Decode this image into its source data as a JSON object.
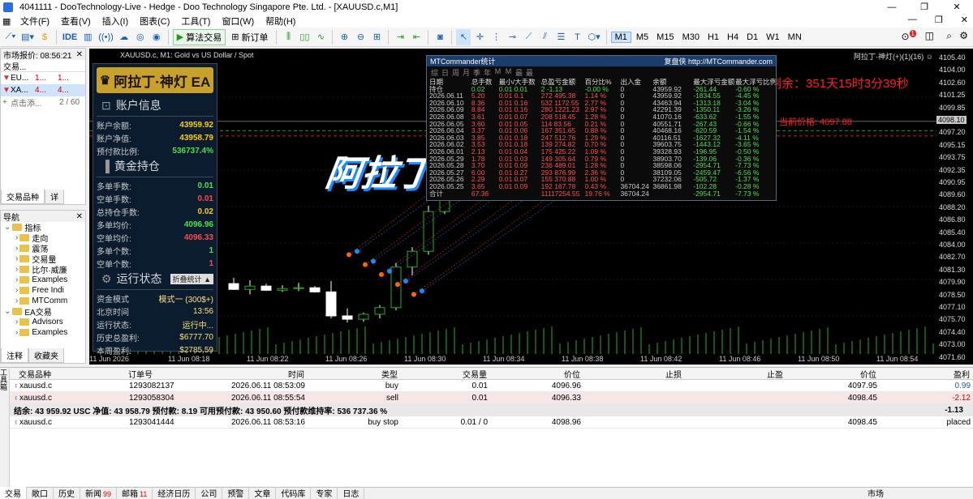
{
  "window": {
    "title": "4041111 - DooTechnology-Live - Hedge - Doo Technology Singapore Pte. Ltd. - [XAUUSD.c,M1]"
  },
  "menu": [
    "文件(F)",
    "查看(V)",
    "插入(I)",
    "图表(C)",
    "工具(T)",
    "窗口(W)",
    "帮助(H)"
  ],
  "toolbar": {
    "ide": "IDE",
    "algo_label": "算法交易",
    "new_order_label": "新订单",
    "timeframes": [
      "M1",
      "M5",
      "M15",
      "M30",
      "H1",
      "H4",
      "D1",
      "W1",
      "MN"
    ],
    "selected_tf": "M1",
    "alerts_badge": "1"
  },
  "market_watch": {
    "header": "市场报价: 08:56:21",
    "col_symbol": "交易...",
    "rows": [
      {
        "symbol": "EU...",
        "bid": "1...",
        "ask": "1..."
      },
      {
        "symbol": "XA...",
        "bid": "4...",
        "ask": "4..."
      }
    ],
    "add_label": "点击添...",
    "count": "2 / 60",
    "tabs": [
      "交易品种",
      "详"
    ]
  },
  "navigator": {
    "header": "导航",
    "items": [
      {
        "label": "指标",
        "level": 1
      },
      {
        "label": "走向",
        "level": 2
      },
      {
        "label": "震荡",
        "level": 2
      },
      {
        "label": "交易量",
        "level": 2
      },
      {
        "label": "比尔·威廉",
        "level": 2
      },
      {
        "label": "Examples",
        "level": 2
      },
      {
        "label": "Free Indi",
        "level": 2
      },
      {
        "label": "MTComm",
        "level": 2
      },
      {
        "label": "EA交易",
        "level": 1
      },
      {
        "label": "Advisors",
        "level": 2
      },
      {
        "label": "Examples",
        "level": 2
      }
    ],
    "tabs": [
      "注释",
      "收藏夹"
    ]
  },
  "chart": {
    "symbol_title": "XAUUSD.c, M1: Gold vs US Dollar / Spot",
    "ea_name_top": "阿拉丁·神灯(+)(1)(16) ☺",
    "countdown": "剩余：351天15时3分39秒",
    "price_tag": "当前价格: 4097.88",
    "big_text": "阿拉丁",
    "price_labels": [
      "4105.40",
      "4104.00",
      "4102.60",
      "4101.25",
      "4099.85",
      "4098.10",
      "4097.20",
      "4095.15",
      "4093.75",
      "4092.35",
      "4090.95",
      "4089.60",
      "4088.20",
      "4086.80",
      "4085.40",
      "4084.00",
      "4082.70",
      "4081.30",
      "4079.90",
      "4078.50",
      "4077.10",
      "4075.70",
      "4074.40",
      "4073.00",
      "4071.60"
    ],
    "current_price_label": "4098.10",
    "time_labels": [
      "11 Jun 2026",
      "11 Jun 08:18",
      "11 Jun 08:22",
      "11 Jun 08:26",
      "11 Jun 08:30",
      "11 Jun 08:34",
      "11 Jun 08:38",
      "11 Jun 08:42",
      "11 Jun 08:46",
      "11 Jun 08:50",
      "11 Jun 08:54"
    ],
    "candles": [
      {
        "o": 4078.5,
        "h": 4079.2,
        "l": 4077.9,
        "c": 4077.8
      },
      {
        "o": 4077.8,
        "h": 4078.9,
        "l": 4077.2,
        "c": 4078.2
      },
      {
        "o": 4078.2,
        "h": 4078.5,
        "l": 4077.6,
        "c": 4077.7
      },
      {
        "o": 4077.7,
        "h": 4078.3,
        "l": 4077.5,
        "c": 4077.9
      },
      {
        "o": 4077.9,
        "h": 4078.6,
        "l": 4077.6,
        "c": 4078.0
      },
      {
        "o": 4078.0,
        "h": 4078.2,
        "l": 4077.4,
        "c": 4077.5
      },
      {
        "o": 4077.5,
        "h": 4078.8,
        "l": 4074.3,
        "c": 4074.6
      },
      {
        "o": 4074.6,
        "h": 4075.5,
        "l": 4073.8,
        "c": 4074.2
      },
      {
        "o": 4074.2,
        "h": 4075.0,
        "l": 4073.9,
        "c": 4074.8
      },
      {
        "o": 4074.8,
        "h": 4075.9,
        "l": 4074.3,
        "c": 4075.6
      },
      {
        "o": 4075.6,
        "h": 4081.0,
        "l": 4075.3,
        "c": 4080.5
      },
      {
        "o": 4080.5,
        "h": 4082.9,
        "l": 4079.5,
        "c": 4082.4
      },
      {
        "o": 4082.4,
        "h": 4087.9,
        "l": 4082.0,
        "c": 4087.2
      },
      {
        "o": 4087.2,
        "h": 4093.5,
        "l": 4086.9,
        "c": 4092.8
      }
    ]
  },
  "ea_panel": {
    "title": "阿拉丁·神灯 EA",
    "account_header": "账户信息",
    "account": [
      {
        "label": "账户余额:",
        "value": "43959.92",
        "cls": "y"
      },
      {
        "label": "账户净值:",
        "value": "43958.79",
        "cls": "y"
      },
      {
        "label": "预付款比例:",
        "value": "536737.4%",
        "cls": "g"
      }
    ],
    "gold_header": "黄金持仓",
    "gold": [
      {
        "label": "多单手数:",
        "value": "0.01",
        "cls": "g"
      },
      {
        "label": "空单手数:",
        "value": "0.01",
        "cls": "r"
      },
      {
        "label": "总持仓手数:",
        "value": "0.02",
        "cls": "y"
      },
      {
        "label": "多单均价:",
        "value": "4096.96",
        "cls": "g"
      },
      {
        "label": "空单均价:",
        "value": "4096.33",
        "cls": "r"
      },
      {
        "label": "多单个数:",
        "value": "1",
        "cls": "g"
      },
      {
        "label": "空单个数:",
        "value": "1",
        "cls": "r"
      }
    ],
    "run_header": "运行状态",
    "run_toggle": "折叠统计 ▲",
    "run": [
      {
        "label": "资金模式",
        "value": "模式一 (300$+)"
      },
      {
        "label": "北京时间",
        "value": "13:56"
      },
      {
        "label": "运行状态:",
        "value": "运行中..."
      },
      {
        "label": "历史总盈利:",
        "value": "$6777.70"
      },
      {
        "label": "本周盈利:",
        "value": "$2785.59"
      }
    ]
  },
  "mtc": {
    "title": "MTCommander统计",
    "brand": "复盘侠 http://MTCommander.com",
    "tabs": [
      "综",
      "日",
      "周",
      "月",
      "季",
      "年",
      "M",
      "M",
      "最",
      "最"
    ],
    "headers": [
      "日期",
      "总手数",
      "最小/大手数",
      "总盈亏金额",
      "百分比%",
      "出入金",
      "余额",
      "最大浮亏金额",
      "最大浮亏比例"
    ],
    "rows": [
      [
        "持仓",
        "0.02",
        "0.01 0.01",
        "2 -1.13",
        "-0.00 %",
        "0",
        "43959.92",
        "-261.44",
        "-0.60 %"
      ],
      [
        "2026.06.11",
        "5.20",
        "0.01 0.1",
        "272 495.38",
        "1.14 %",
        "0",
        "43959.92",
        "-1834.55",
        "-4.45 %"
      ],
      [
        "2026.06.10",
        "8.36",
        "0.01 0.16",
        "532 1172.55",
        "2.77 %",
        "0",
        "43463.94",
        "-1313.18",
        "-3.04 %"
      ],
      [
        "2026.06.09",
        "8.84",
        "0.01 0.16",
        "280 1221.23",
        "2.97 %",
        "0",
        "42291.39",
        "-1350.11",
        "-3.26 %"
      ],
      [
        "2026.06.08",
        "3.61",
        "0.01 0.07",
        "208 518.45",
        "1.28 %",
        "0",
        "41070.16",
        "-633.62",
        "-1.55 %"
      ],
      [
        "2026.06.05",
        "3.60",
        "0.01 0.05",
        "114 83.56",
        "0.21 %",
        "0",
        "40551.71",
        "-267.43",
        "-0.66 %"
      ],
      [
        "2026.06.04",
        "3.37",
        "0.01 0.06",
        "167 351.65",
        "0.88 %",
        "0",
        "40468.16",
        "-620.59",
        "-1.54 %"
      ],
      [
        "2026.06.03",
        "3.85",
        "0.01 0.18",
        "247 512.76",
        "1.29 %",
        "0",
        "40116.51",
        "-1627.32",
        "-4.11 %"
      ],
      [
        "2026.06.02",
        "3.53",
        "0.01 0.18",
        "139 274.82",
        "0.70 %",
        "0",
        "39603.75",
        "-1443.12",
        "-3.65 %"
      ],
      [
        "2026.06.01",
        "2.13",
        "0.01 0.04",
        "175 425.22",
        "1.09 %",
        "0",
        "39328.93",
        "-196.95",
        "-0.50 %"
      ],
      [
        "2026.05.29",
        "1.78",
        "0.01 0.03",
        "149 305.64",
        "0.79 %",
        "0",
        "38903.70",
        "-139.06",
        "-0.36 %"
      ],
      [
        "2026.05.28",
        "3.70",
        "0.01 0.09",
        "236 489.01",
        "1.28 %",
        "0",
        "38598.06",
        "-2954.71",
        "-7.73 %"
      ],
      [
        "2026.05.27",
        "6.00",
        "0.01 0.27",
        "293 876.99",
        "2.36 %",
        "0",
        "38109.05",
        "-2459.47",
        "-6.56 %"
      ],
      [
        "2026.05.26",
        "2.29",
        "0.01 0.07",
        "155 370.88",
        "1.00 %",
        "0",
        "37232.06",
        "-505.72",
        "-1.37 %"
      ],
      [
        "2026.05.25",
        "3.65",
        "0.01 0.09",
        "192 167.78",
        "0.43 %",
        "36704.24",
        "36861.98",
        "-102.28",
        "-0.28 %"
      ],
      [
        "合计",
        "67.36",
        "",
        "11117254.55",
        "19.76 %",
        "36704.24",
        "",
        "-2954.71",
        "-7.73 %"
      ]
    ]
  },
  "positions": {
    "headers": [
      "交易品种",
      "订单号",
      "时间",
      "类型",
      "交易量",
      "价位",
      "止损",
      "止盈",
      "价位",
      "盈利"
    ],
    "rows": [
      {
        "symbol": "xauusd.c",
        "order": "1293082137",
        "time": "2026.06.11 08:53:09",
        "type": "buy",
        "volume": "0.01",
        "price": "4096.96",
        "sl": "",
        "tp": "",
        "cur": "4097.95",
        "profit": "0.99",
        "pcls": "pos"
      },
      {
        "symbol": "xauusd.c",
        "order": "1293058304",
        "time": "2026.06.11 08:55:54",
        "type": "sell",
        "volume": "0.01",
        "price": "4096.33",
        "sl": "",
        "tp": "",
        "cur": "4098.45",
        "profit": "-2.12",
        "pcls": "neg"
      }
    ],
    "summary": "结余: 43 959.92 USC  净值: 43 958.79  预付款: 8.19  可用预付款: 43 950.60  预付款维持率: 536 737.36 %",
    "summary_profit": "-1.13",
    "pending": {
      "symbol": "xauusd.c",
      "order": "1293041444",
      "time": "2026.06.11 08:53:16",
      "type": "buy stop",
      "volume": "0.01 / 0",
      "price": "4098.96",
      "cur": "4098.45",
      "status": "placed"
    }
  },
  "bottom_tabs": [
    {
      "label": "交易",
      "badge": ""
    },
    {
      "label": "敞口",
      "badge": ""
    },
    {
      "label": "历史",
      "badge": ""
    },
    {
      "label": "新闻",
      "badge": "99"
    },
    {
      "label": "邮箱",
      "badge": "11"
    },
    {
      "label": "经济日历",
      "badge": ""
    },
    {
      "label": "公司",
      "badge": ""
    },
    {
      "label": "预警",
      "badge": ""
    },
    {
      "label": "文章",
      "badge": ""
    },
    {
      "label": "代码库",
      "badge": ""
    },
    {
      "label": "专家",
      "badge": ""
    },
    {
      "label": "日志",
      "badge": ""
    }
  ],
  "status": {
    "market": "市场",
    "side_label": "工具箱"
  }
}
